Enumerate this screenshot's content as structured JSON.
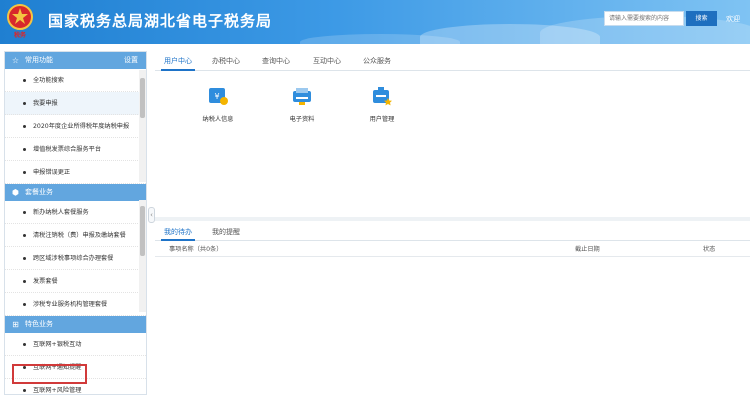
{
  "header": {
    "logo_text": "税务",
    "title": "国家税务总局湖北省电子税务局",
    "search_placeholder": "请输入需要搜索的内容",
    "search_button": "搜索",
    "welcome": "欢迎"
  },
  "sidebar": {
    "sections": [
      {
        "title": "常用功能",
        "icon": "star-icon",
        "settings_label": "设置",
        "items": [
          "全功能搜索",
          "我要申报",
          "2020年度企业所得税年度纳税申报",
          "增值税发票综合服务平台",
          "申报错误更正"
        ]
      },
      {
        "title": "套餐业务",
        "icon": "cube-icon",
        "items": [
          "新办纳税人套餐服务",
          "清税注销税（费）申报及缴纳套餐",
          "跨区域涉税事项综合办理套餐",
          "发票套餐",
          "涉税专业服务机构管理套餐"
        ]
      },
      {
        "title": "特色业务",
        "icon": "grid-icon",
        "items": [
          "互联网+银税互动",
          "互联网+通知提醒",
          "互联网+风险管理"
        ]
      }
    ]
  },
  "main": {
    "top_tabs": [
      "用户中心",
      "办税中心",
      "查询中心",
      "互动中心",
      "公众服务"
    ],
    "apps": [
      {
        "label": "纳税人信息",
        "icon": "taxpayer-info-icon"
      },
      {
        "label": "电子资料",
        "icon": "electronic-data-icon"
      },
      {
        "label": "用户管理",
        "icon": "user-management-icon"
      }
    ],
    "bottom_tabs": [
      "我的待办",
      "我的提醒"
    ],
    "table_columns": [
      "事项名称（共0条）",
      "截止日期",
      "状态"
    ]
  },
  "colors": {
    "header_blue": "#2f8ddd",
    "section_header": "#62a6df",
    "tab_active": "#1e73c8",
    "highlight_border": "#d13a3a"
  }
}
